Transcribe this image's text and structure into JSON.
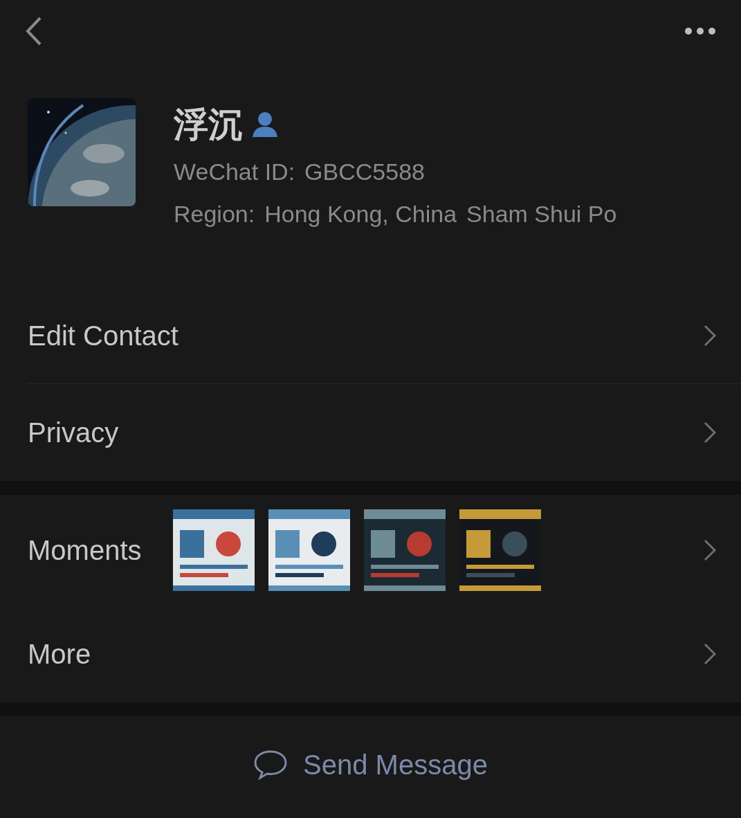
{
  "profile": {
    "name": "浮沉",
    "wechat_id_label": "WeChat ID:",
    "wechat_id": "GBCC5588",
    "region_label": "Region:",
    "region": "Hong Kong, China",
    "district": "Sham Shui Po"
  },
  "groups": [
    {
      "rows": [
        {
          "label": "Edit Contact",
          "kind": "plain"
        },
        {
          "label": "Privacy",
          "kind": "plain"
        }
      ]
    },
    {
      "rows": [
        {
          "label": "Moments",
          "kind": "moments"
        },
        {
          "label": "More",
          "kind": "plain"
        }
      ]
    }
  ],
  "send_button": {
    "label": "Send Message"
  }
}
